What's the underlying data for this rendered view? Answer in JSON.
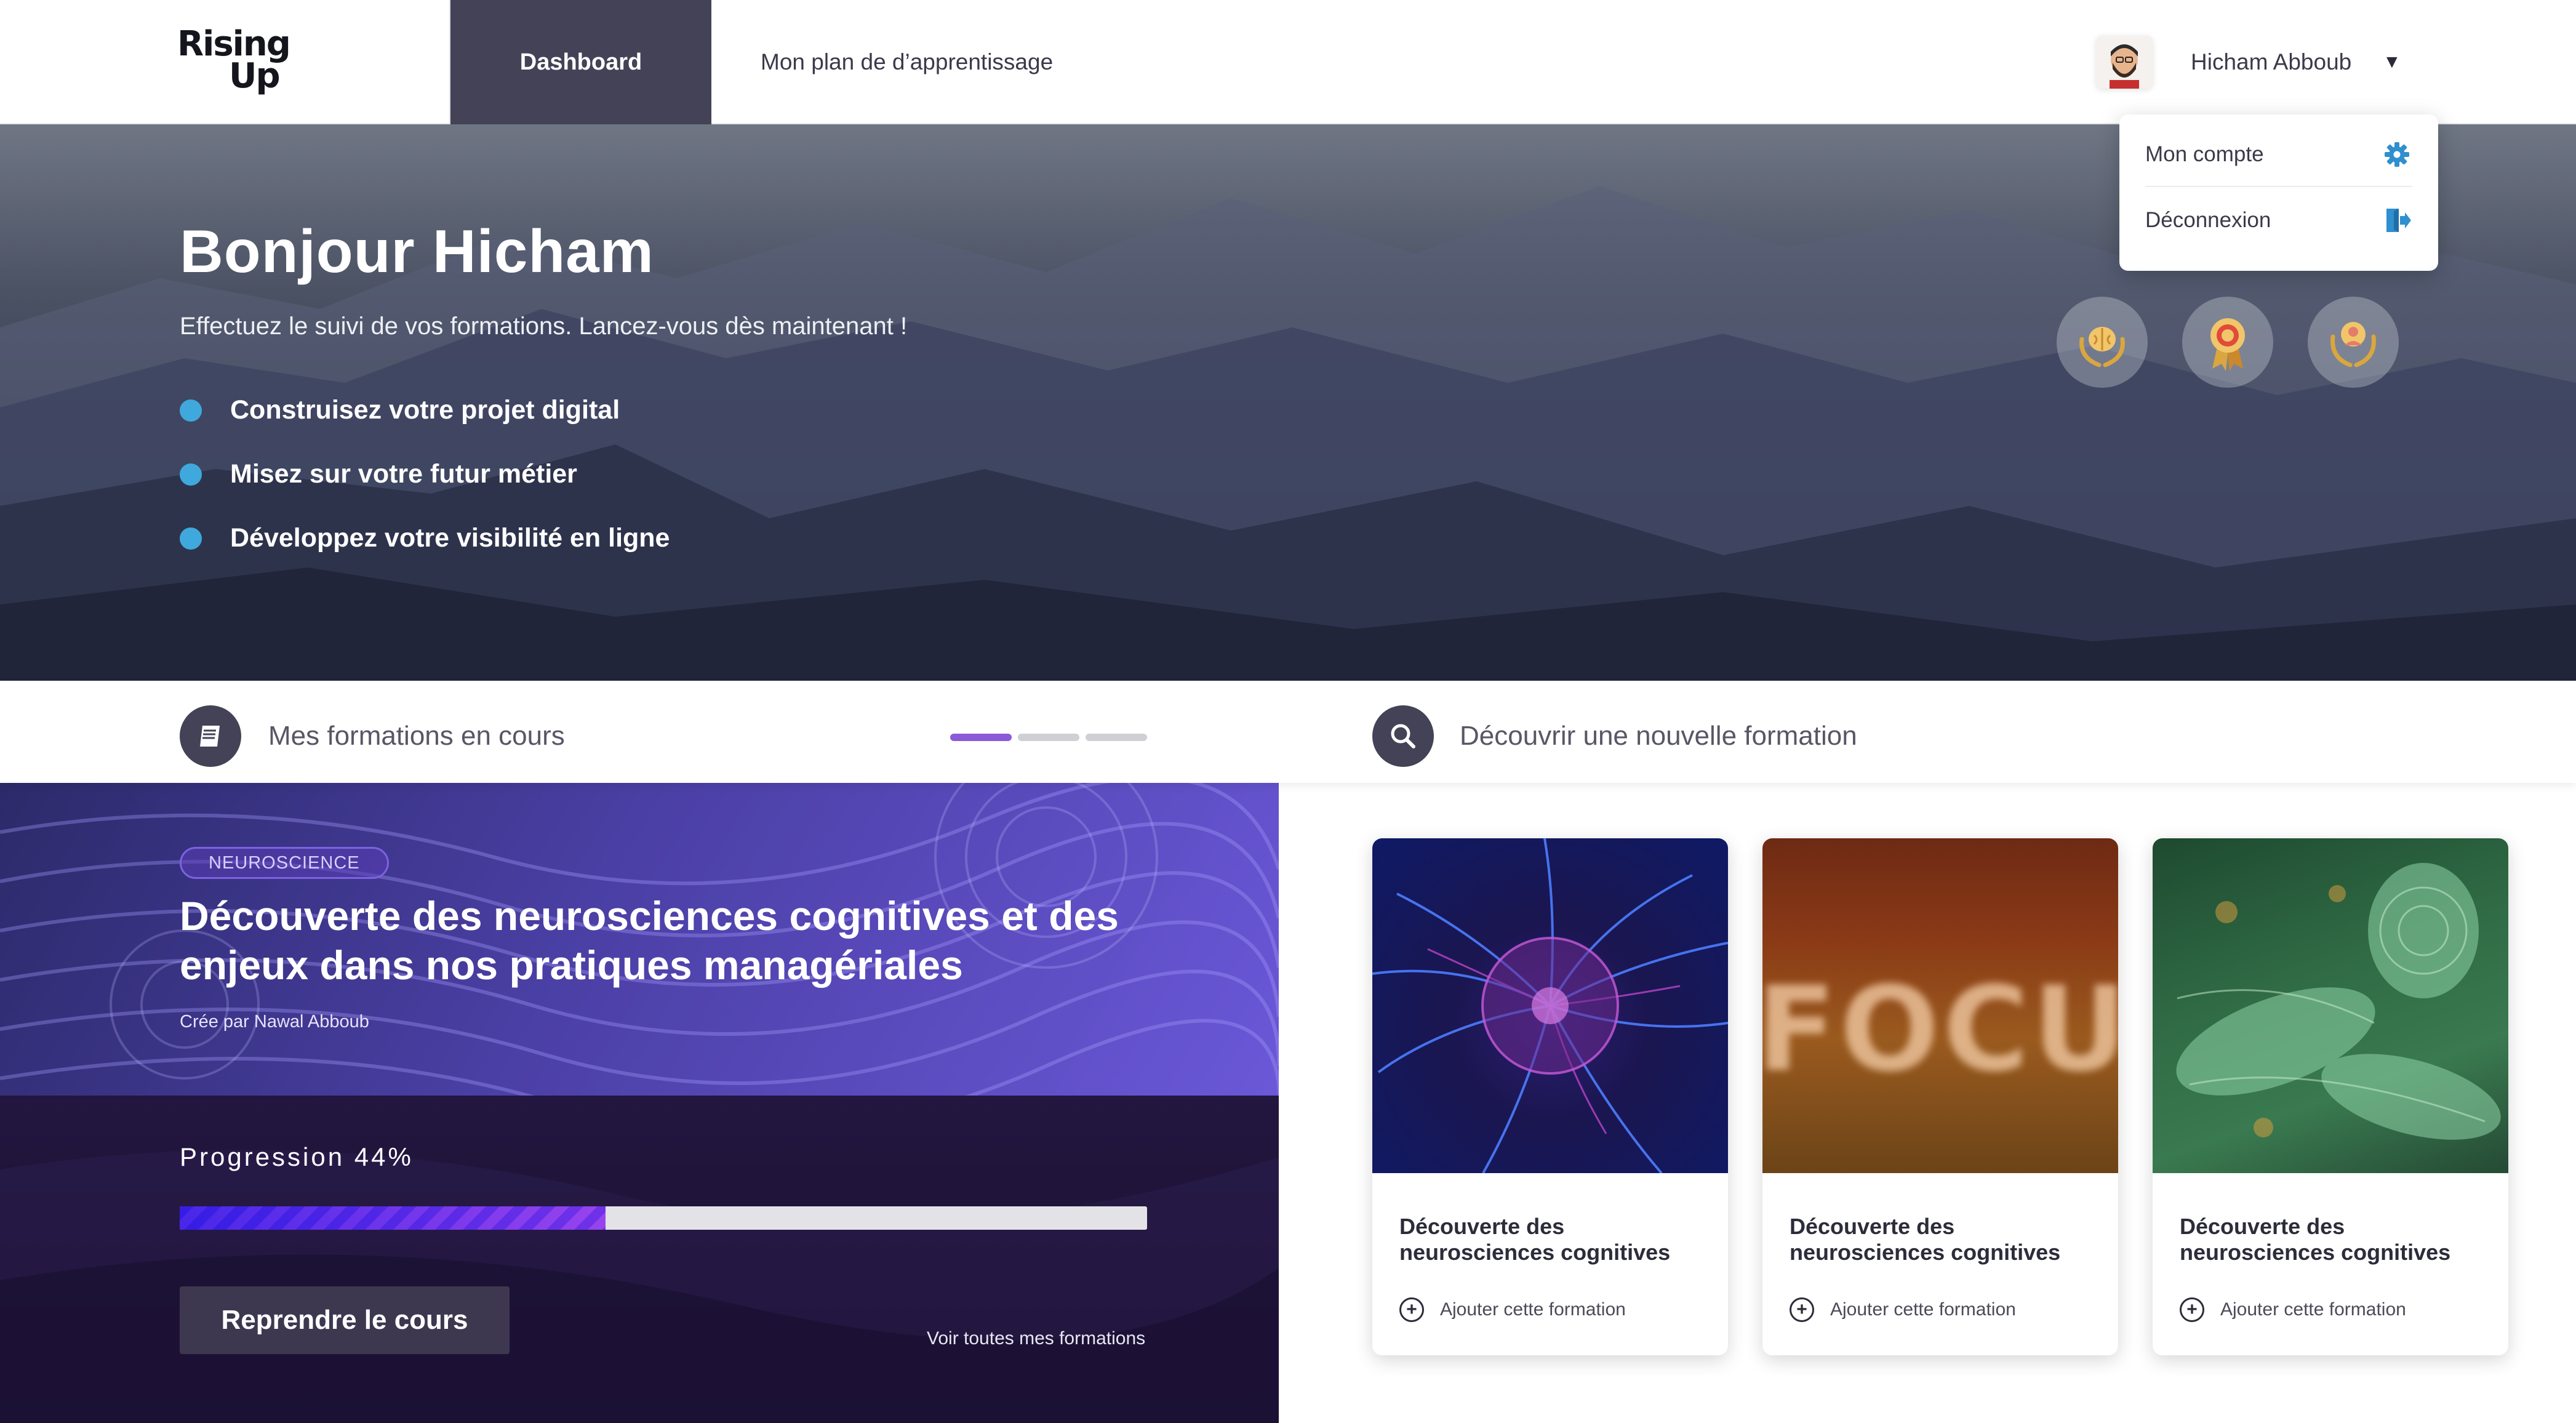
{
  "nav": {
    "logo": {
      "line1": "Rising",
      "line2": "Up"
    },
    "tabs": [
      {
        "label": "Dashboard",
        "active": true
      },
      {
        "label": "Mon plan de  d’apprentissage",
        "active": false
      }
    ],
    "user": {
      "name": "Hicham Abboub",
      "caret": "▼"
    }
  },
  "user_menu": {
    "items": [
      {
        "label": "Mon compte",
        "icon": "gear-icon"
      },
      {
        "label": "Déconnexion",
        "icon": "logout-icon"
      }
    ]
  },
  "hero": {
    "title": "Bonjour Hicham",
    "subtitle": "Effectuez le suivi de vos formations. Lancez-vous dès maintenant !",
    "bullets": [
      "Construisez votre projet digital",
      "Misez sur votre futur métier",
      "Développez votre visibilité en ligne"
    ],
    "badges": [
      "brain-laurel-badge-icon",
      "ribbon-medal-badge-icon",
      "person-laurel-badge-icon"
    ]
  },
  "sections": {
    "current": "Mes formations en cours",
    "discover": "Découvrir une nouvelle formation",
    "pager": {
      "count": 3,
      "active": 1
    }
  },
  "current_course": {
    "tag": "NEUROSCIENCE",
    "title": "Découverte des neurosciences cognitives et des enjeux dans nos pratiques managériales",
    "author": "Crée par Nawal Abboub",
    "progress_label": "Progression 44%",
    "progress": 0.44,
    "resume_label": "Reprendre le cours",
    "all_link": "Voir toutes mes formations"
  },
  "cards": [
    {
      "title": "Découverte des neurosciences cognitives",
      "add_label": "Ajouter cette formation",
      "image": "plasma-ball"
    },
    {
      "title": "Découverte des neurosciences cognitives",
      "add_label": "Ajouter cette formation",
      "image": "focus-letters"
    },
    {
      "title": "Découverte des neurosciences cognitives",
      "add_label": "Ajouter cette formation",
      "image": "wood-fire"
    }
  ],
  "colors": {
    "accent_blue": "#3fa9dd",
    "nav_dark": "#434256",
    "progress_purple": "#7d5cf2",
    "pager_active": "#8a5ad8",
    "pager_inactive": "#cfcfd4"
  }
}
